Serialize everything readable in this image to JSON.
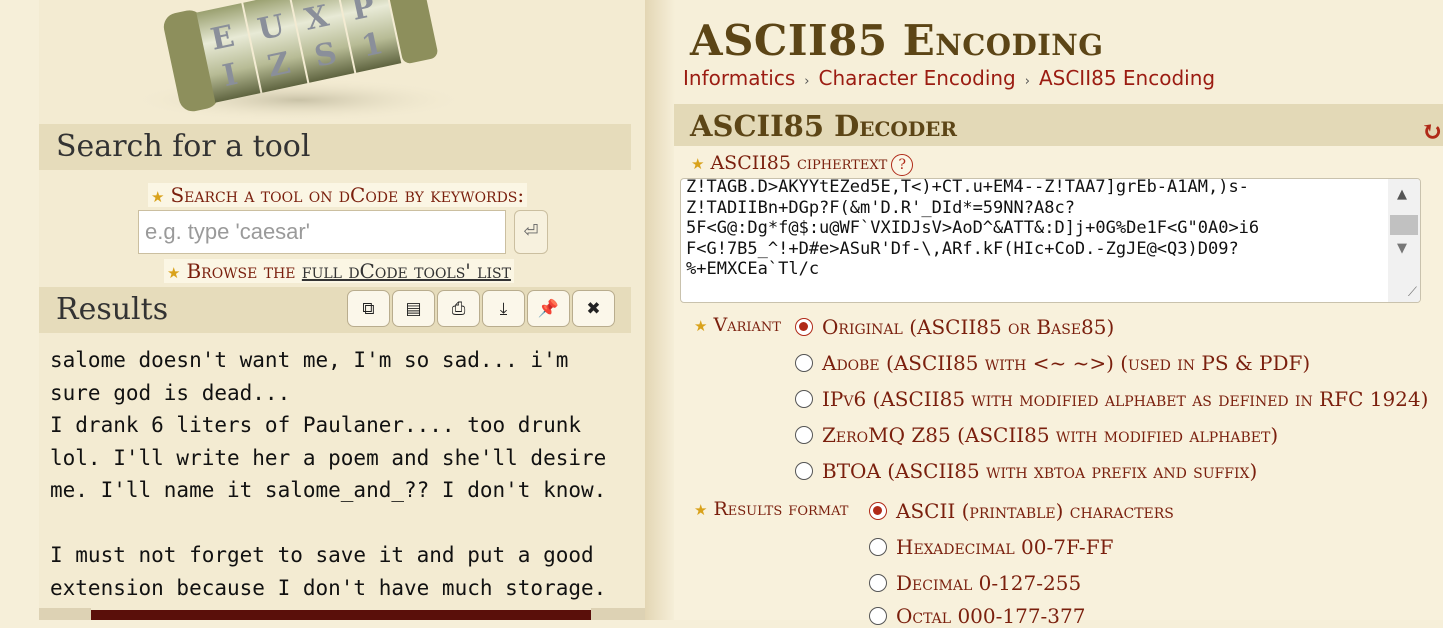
{
  "left": {
    "search_title": "Search for a tool",
    "search_label": "Search a tool on dCode by keywords:",
    "search_placeholder": "e.g. type 'caesar'",
    "browse_prefix": "Browse the ",
    "browse_link": "full dCode tools' list",
    "results_title": "Results",
    "results_text": "salome doesn't want me, I'm so sad... i'm\nsure god is dead...\nI drank 6 liters of Paulaner.... too drunk\nlol. I'll write her a poem and she'll desire\nme. I'll name it salome_and_?? I don't know.\n\nI must not forget to save it and put a good\nextension because I don't have much storage.",
    "tool_icons": [
      "copy-icon",
      "save-icon",
      "print-icon",
      "download-icon",
      "pin-icon",
      "close-icon"
    ]
  },
  "right": {
    "title": "ASCII85 Encoding",
    "breadcrumb": [
      "Informatics",
      "Character Encoding",
      "ASCII85 Encoding"
    ],
    "decoder_title": "ASCII85 Decoder",
    "cipher_label": "ASCII85 ciphertext",
    "help_glyph": "?",
    "ciphertext": "Z!TAGB.D>AKYYtEZed5E,T<)+CT.u+EM4--Z!TAA7]grEb-A1AM,)s-\nZ!TADIIBn+DGp?F(&m'D.R'_DId*=59NN?A8c?\n5F<G@:Dg*f@$:u@WF`VXIDJsV>AoD^&ATT&:D]j+0G%De1F<G\"0A0>i6\nF<G!7B5_^!+D#e>ASuR'Df-\\,ARf.kF(HIc+CoD.-ZgJE@<Q3)D09?\n%+EMXCEa`Tl/c",
    "variant_label": "Variant",
    "variants": [
      "Original (ASCII85 or Base85)",
      "Adobe (ASCII85 with <~ ~>) (used in PS & PDF)",
      "IPv6 (ASCII85 with modified alphabet as defined in RFC 1924)",
      "ZeroMQ Z85 (ASCII85 with modified alphabet)",
      "BTOA (ASCII85 with xbtoa prefix and suffix)"
    ],
    "variant_selected": 0,
    "format_label": "Results format",
    "formats": [
      "ASCII (printable) characters",
      "Hexadecimal 00-7F-FF",
      "Decimal 0-127-255",
      "Octal 000-177-377"
    ],
    "format_selected": 0
  }
}
